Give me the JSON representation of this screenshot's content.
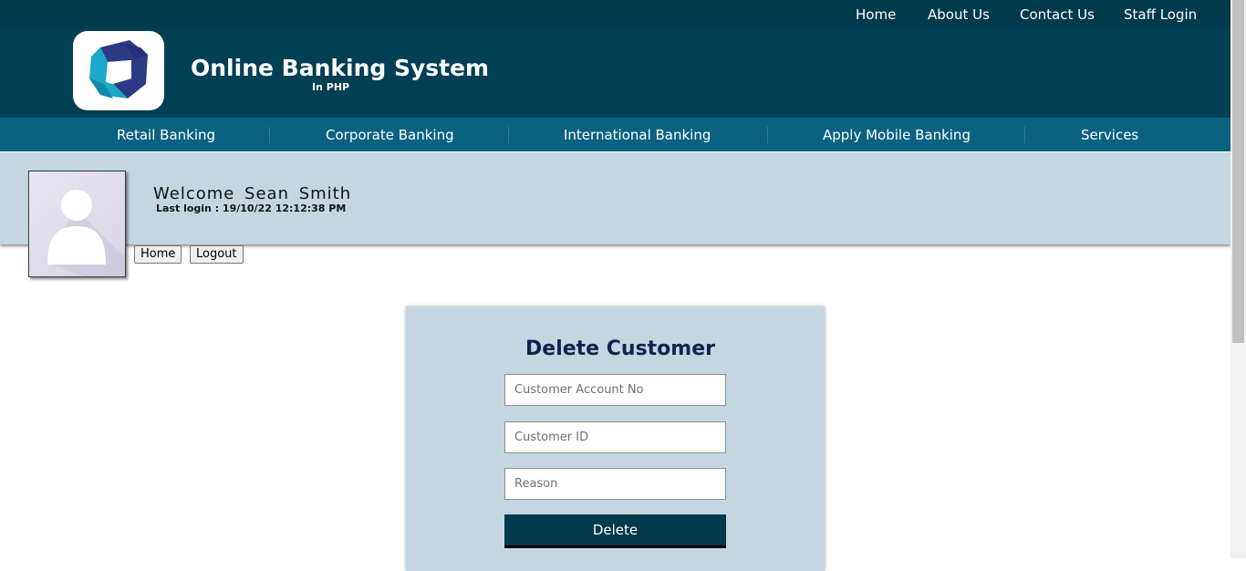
{
  "topnav": {
    "home": "Home",
    "about": "About Us",
    "contact": "Contact Us",
    "staff": "Staff Login"
  },
  "brand": {
    "title": "Online Banking System",
    "subtitle": "In PHP",
    "logo_icon": "bank-logo-icon"
  },
  "mainnav": {
    "items": [
      "Retail Banking",
      "Corporate Banking",
      "International Banking",
      "Apply Mobile Banking",
      "Services"
    ]
  },
  "user": {
    "welcome": "Welcome  Sean  Smith",
    "last_login": "Last login : 19/10/22 12:12:38 PM",
    "avatar_icon": "user-avatar-icon"
  },
  "actions": {
    "home": "Home",
    "logout": "Logout"
  },
  "form": {
    "title": "Delete Customer",
    "account_placeholder": "Customer Account No",
    "id_placeholder": "Customer ID",
    "reason_placeholder": "Reason",
    "submit": "Delete"
  },
  "colors": {
    "topbar": "#003a4c",
    "header": "#003f54",
    "mainnav": "#0a6280",
    "panel": "#c4d7e0",
    "title": "#0c2452"
  }
}
